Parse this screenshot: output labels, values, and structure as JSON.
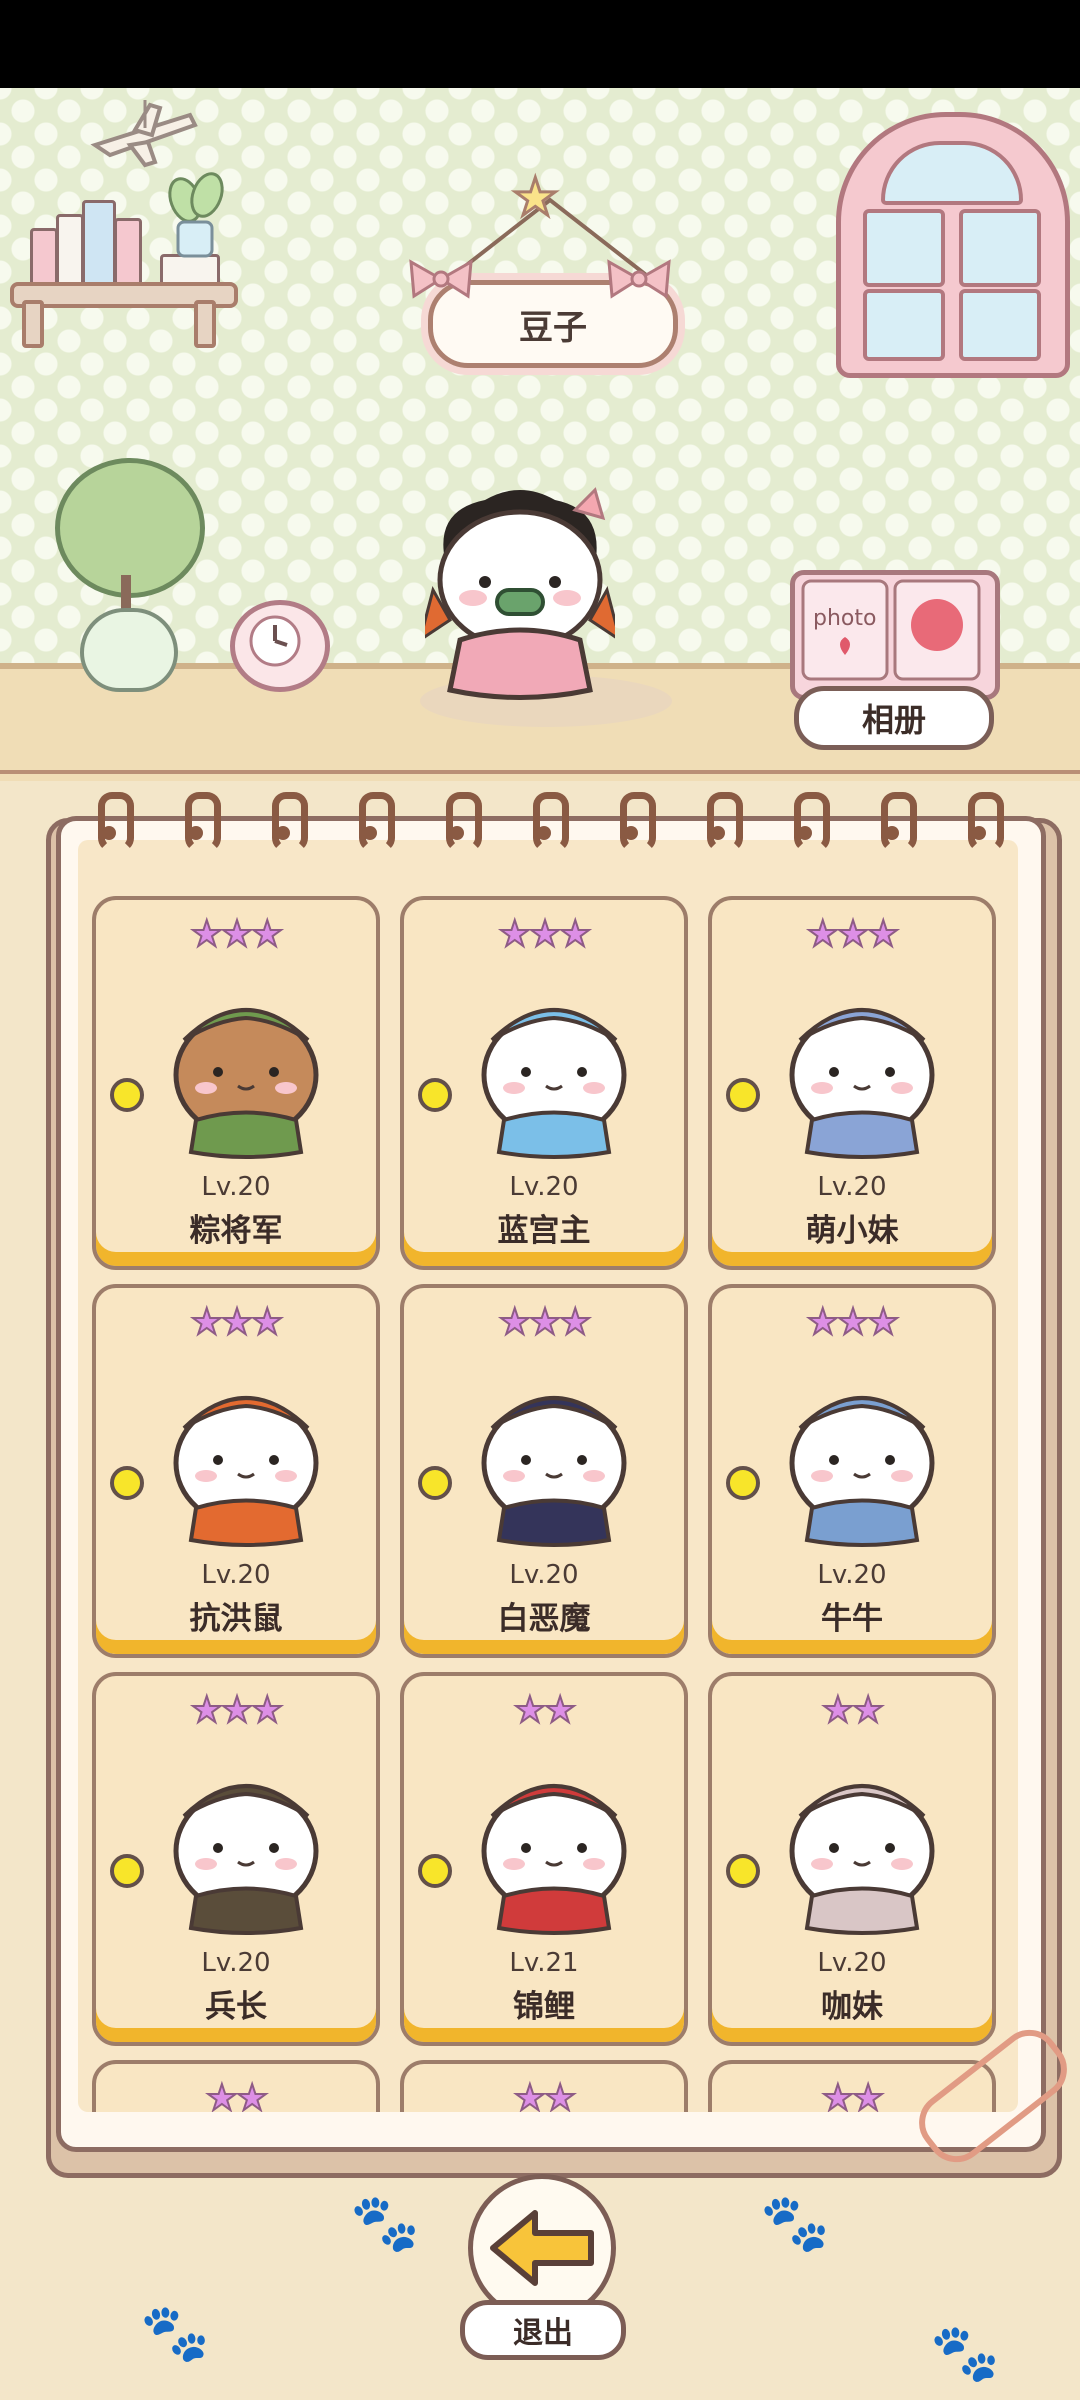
{
  "room": {
    "pet_name": "豆子",
    "album_label": "相册",
    "album_cover_text": "photo"
  },
  "cards": [
    {
      "stars": "★★★",
      "level": "Lv.20",
      "name": "粽将军",
      "color": "#c58a5b",
      "accent": "#6f9a4e"
    },
    {
      "stars": "★★★",
      "level": "Lv.20",
      "name": "蓝宫主",
      "color": "#ffffff",
      "accent": "#7bbfe8"
    },
    {
      "stars": "★★★",
      "level": "Lv.20",
      "name": "萌小妹",
      "color": "#ffffff",
      "accent": "#8aa4d6"
    },
    {
      "stars": "★★★",
      "level": "Lv.20",
      "name": "抗洪鼠",
      "color": "#ffffff",
      "accent": "#e36a30"
    },
    {
      "stars": "★★★",
      "level": "Lv.20",
      "name": "白恶魔",
      "color": "#ffffff",
      "accent": "#34345a"
    },
    {
      "stars": "★★★",
      "level": "Lv.20",
      "name": "牛牛",
      "color": "#ffffff",
      "accent": "#7a9fd0"
    },
    {
      "stars": "★★★",
      "level": "Lv.20",
      "name": "兵长",
      "color": "#ffffff",
      "accent": "#5a4d3a"
    },
    {
      "stars": "★★",
      "level": "Lv.21",
      "name": "锦鲤",
      "color": "#ffffff",
      "accent": "#d03b3b"
    },
    {
      "stars": "★★",
      "level": "Lv.20",
      "name": "咖妹",
      "color": "#ffffff",
      "accent": "#d9c6c6"
    },
    {
      "stars": "★★",
      "level": "",
      "name": "",
      "color": "#ffffff",
      "accent": "#ffffff"
    },
    {
      "stars": "★★",
      "level": "",
      "name": "",
      "color": "#ffffff",
      "accent": "#ffffff"
    },
    {
      "stars": "★★",
      "level": "",
      "name": "",
      "color": "#ffffff",
      "accent": "#ffffff"
    }
  ],
  "exit": {
    "label": "退出"
  }
}
